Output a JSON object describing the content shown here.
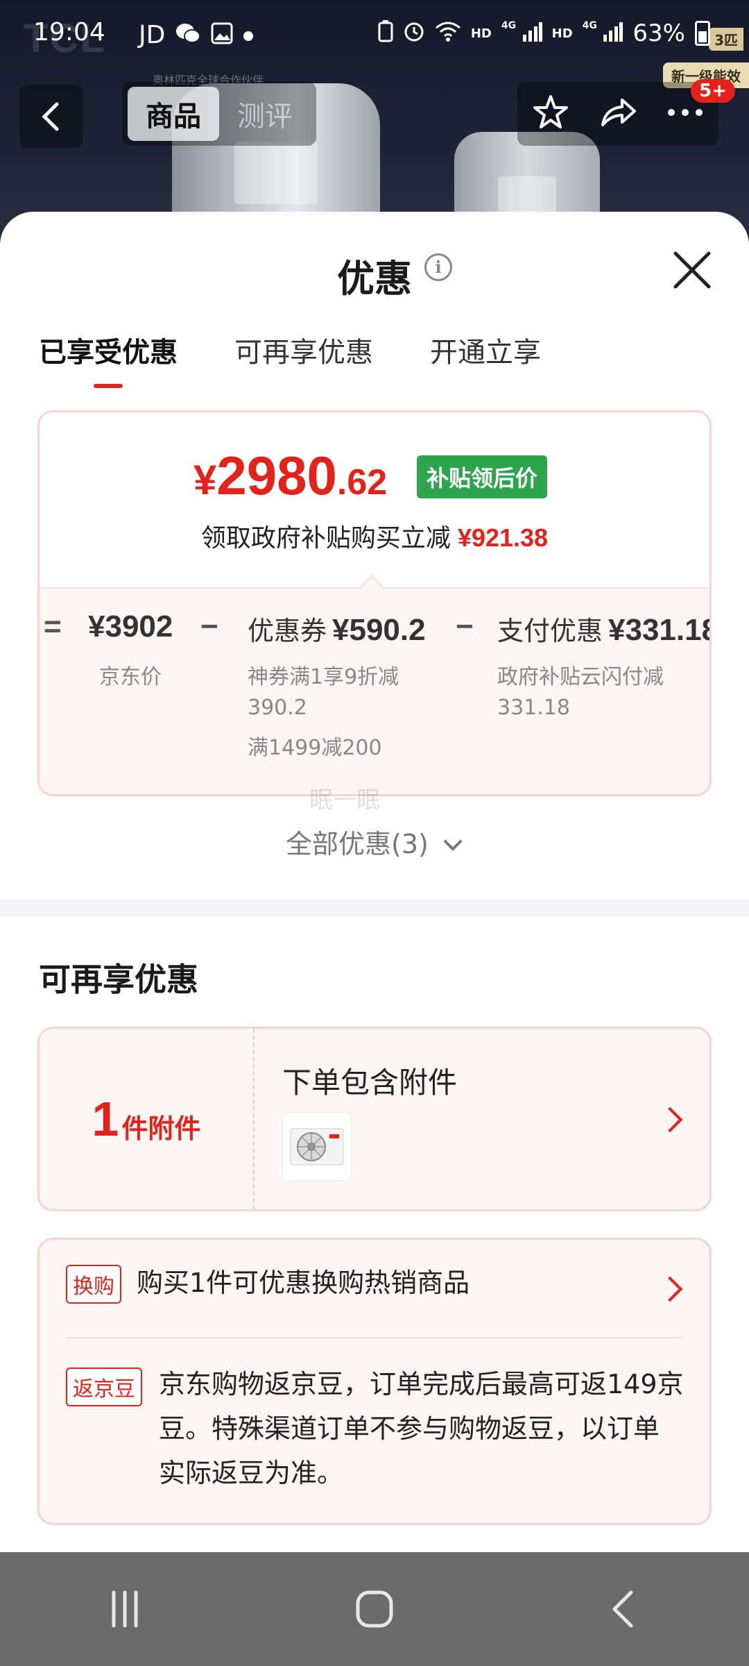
{
  "status_bar": {
    "time": "19:04",
    "carrier_label": "JD",
    "net1": "HD",
    "net1_gen": "4G",
    "net2": "HD",
    "net2_gen": "4G",
    "battery": "63%"
  },
  "background": {
    "brand_logo": "TCL",
    "brand_sub": "奥林匹克全球合作伙伴",
    "badge_top": "3匹",
    "badge_energy": "新一级能效"
  },
  "product_nav": {
    "tabs": [
      {
        "label": "商品",
        "active": true
      },
      {
        "label": "测评",
        "active": false
      }
    ],
    "cart_count": "5+"
  },
  "sheet": {
    "title": "优惠",
    "info_glyph": "i",
    "tabs": [
      {
        "label": "已享受优惠",
        "active": true
      },
      {
        "label": "可再享优惠",
        "active": false
      },
      {
        "label": "开通立享",
        "active": false
      }
    ],
    "price_card": {
      "final_price": {
        "currency": "¥",
        "integer": "2980",
        "decimal": ".62"
      },
      "subsidy_tag": "补贴领后价",
      "gov_text": "领取政府补贴购买立减",
      "gov_amount": "¥921.38",
      "breakdown": {
        "equals": "=",
        "minus": "−",
        "jd_price": "¥3902",
        "jd_price_label": "京东价",
        "coupon_label": "优惠券",
        "coupon_value": "¥590.2",
        "coupon_desc_1": "神券满1享9折减",
        "coupon_desc_2": "390.2",
        "coupon_desc_3": "满1499减200",
        "pay_label": "支付优惠",
        "pay_value": "¥331.18",
        "pay_desc_1": "政府补贴云闪付减",
        "pay_desc_2": "331.18"
      }
    },
    "watermark": "眠一眠",
    "all_offers": "全部优惠(3)",
    "more_section": {
      "title": "可再享优惠",
      "accessory": {
        "count": "1",
        "unit": "件附件",
        "title": "下单包含附件"
      },
      "perks": [
        {
          "tag": "换购",
          "text": "购买1件可优惠换购热销商品"
        },
        {
          "tag": "返京豆",
          "text_line1": "京东购物返京豆，订单完成后最高可返149京",
          "text_line2": "豆。特殊渠道订单不参与购物返豆，以订单",
          "text_line3": "实际返豆为准。"
        }
      ]
    }
  },
  "colors": {
    "accent_red": "#e2231a",
    "subsidy_green": "#2ea44f",
    "card_pink": "#fdf4f4"
  }
}
